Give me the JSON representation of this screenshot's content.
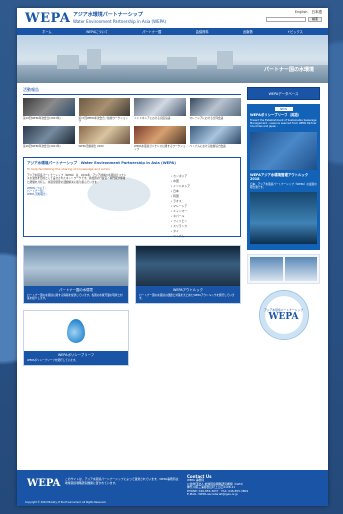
{
  "header": {
    "logo": "WEPA",
    "title_jp": "アジア水環境パートナーシップ",
    "title_en": "Water Environment Partnership in Asia (WEPA)",
    "links": [
      "English",
      "日本語"
    ],
    "search_button": "検索"
  },
  "nav": [
    "ホーム",
    "WEPAについて",
    "パートナー国",
    "会議資料",
    "出版物",
    "トピックス"
  ],
  "hero": {
    "caption": "パートナー国の水環境"
  },
  "news": {
    "heading": "活動報告",
    "items": [
      {
        "caption": "第18回WEPA年次会合(2023年)"
      },
      {
        "caption": "第17回WEPA年次会合 / 技術ワークショップ"
      },
      {
        "caption": "インドネシアにおける官民協議"
      },
      {
        "caption": "マレーシアにおける合同会議"
      },
      {
        "caption": "第16回WEPA年次会合(2021年)"
      },
      {
        "caption": "WEPA活動報告 2020"
      },
      {
        "caption": "WEPA水環境ガバナンスに関するワークショップ"
      },
      {
        "caption": "ベトナムにおける技術協力会議"
      }
    ]
  },
  "about": {
    "heading": "アジア水環境パートナーシップ　Water Environment Partnership in Asia (WEPA)",
    "subheading": "To help facilitating the sharing of knowledge and action",
    "body": "アジア水環境パートナーシップ（WEPA）は、2004年、アジア地域の水環境ガバナンスの強化を目的として設立されたネットワークです。参加国の行政官・専門家が情報と経験を共有し、水環境管理の課題解決に取り組んでいます。",
    "links": [
      "WEPAについて ›",
      "パートナー国 ›",
      "WEPA 活動報告 ›"
    ],
    "countries": [
      "カンボジア",
      "中国",
      "インドネシア",
      "日本",
      "韓国",
      "ラオス",
      "マレーシア",
      "ミャンマー",
      "ネパール",
      "フィリピン",
      "スリランカ",
      "タイ",
      "ベトナム"
    ]
  },
  "cards": [
    {
      "title": "パートナー国の水環境",
      "text": "パートナー国の水環境に関する情報を提供しています。各国の水質汚濁の現状と対策を紹介します。"
    },
    {
      "title": "WEPAアウトルック",
      "text": "パートナー国の水環境の課題と対策をまとめたWEPAアウトルックを発行しています。"
    },
    {
      "title": "WEPAポリシーブリーフ",
      "text": "WEPAポリシーブリーフを発行しています。"
    }
  ],
  "sidebar": {
    "button": "WEPAデータベース",
    "new_label": "NEW",
    "panel_heading": "WEPAポリシーブリーフ（英語）",
    "panel_subheading": "Toward the Establishment of Sustainable Sewerage Management - Lessons Learned from WEPA Partner Countries and Japan -",
    "outlook_heading": "WEPAアジア水環境管理アウトルック 2018",
    "outlook_text": "日本、アジア水環境パートナーシップ（WEPA）の最新の報告書です。",
    "badge_jp": "アジア水環境パートナーシップ",
    "badge_logo": "WEPA"
  },
  "footer": {
    "logo": "WEPA",
    "text": "このサイトは、アジア水環境パートナーシップによって運営されています。WEPA事務局は地球環境戦略研究機関に置かれています。",
    "contact_heading": "Contact Us",
    "contact_lines": [
      "WEPA 事務局",
      "公益財団法人 地球環境戦略研究機関（IGES）",
      "神奈川県三浦郡葉山町上山口2108-11",
      "PHONE: 046-855-3837　FAX: 046-855-3809",
      "E-MAIL: WEPA-secretariat@iges.or.jp"
    ],
    "copyright": "Copyright © 2024 Ministry of the Environment. All Rights Reserved."
  },
  "colors": {
    "primary": "#1954a6",
    "accent": "#d06020",
    "background": "#2a4d7a"
  }
}
